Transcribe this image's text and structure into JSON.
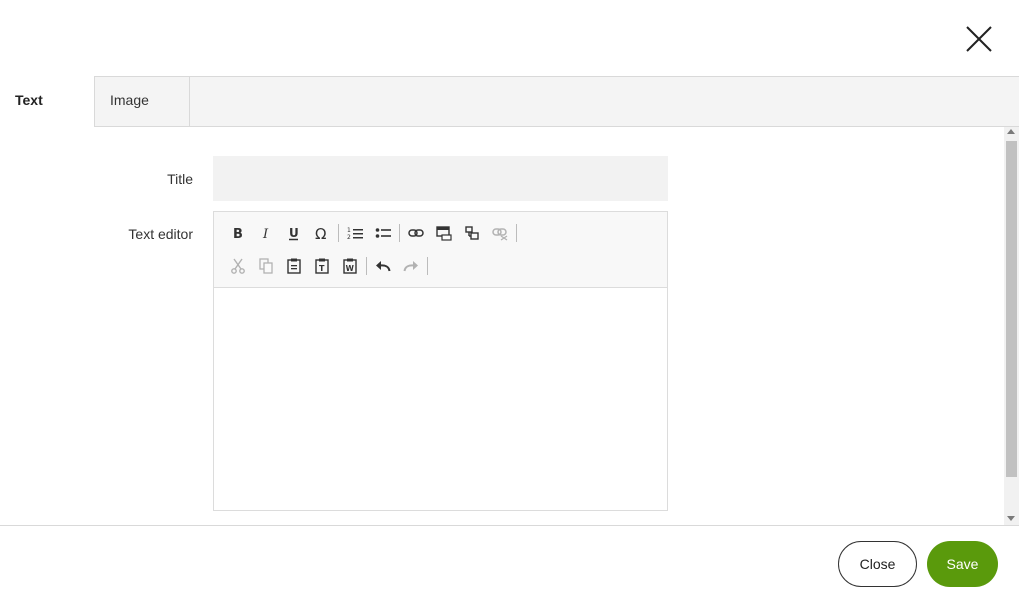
{
  "tabs": [
    {
      "label": "Text",
      "active": true
    },
    {
      "label": "Image",
      "active": false
    }
  ],
  "form": {
    "title_label": "Title",
    "title_value": "",
    "editor_label": "Text editor",
    "editor_value": ""
  },
  "toolbar": {
    "row1": [
      "bold-icon",
      "italic-icon",
      "underline-icon",
      "special-char-omega-icon",
      "numbered-list-icon",
      "bulleted-list-icon",
      "link-icon",
      "anchor-icon",
      "insert-link-icon",
      "unlink-icon"
    ],
    "row2": [
      "cut-icon",
      "copy-icon",
      "paste-icon",
      "paste-text-icon",
      "paste-word-icon",
      "undo-icon",
      "redo-icon"
    ],
    "disabled": [
      "unlink-icon",
      "cut-icon",
      "copy-icon",
      "redo-icon"
    ]
  },
  "footer": {
    "close_label": "Close",
    "save_label": "Save"
  },
  "colors": {
    "save_button": "#5a9a0c",
    "tabbar_bg": "#f4f4f4",
    "input_bg": "#f2f2f2"
  },
  "icons": {
    "dialog_close": "close-icon"
  }
}
